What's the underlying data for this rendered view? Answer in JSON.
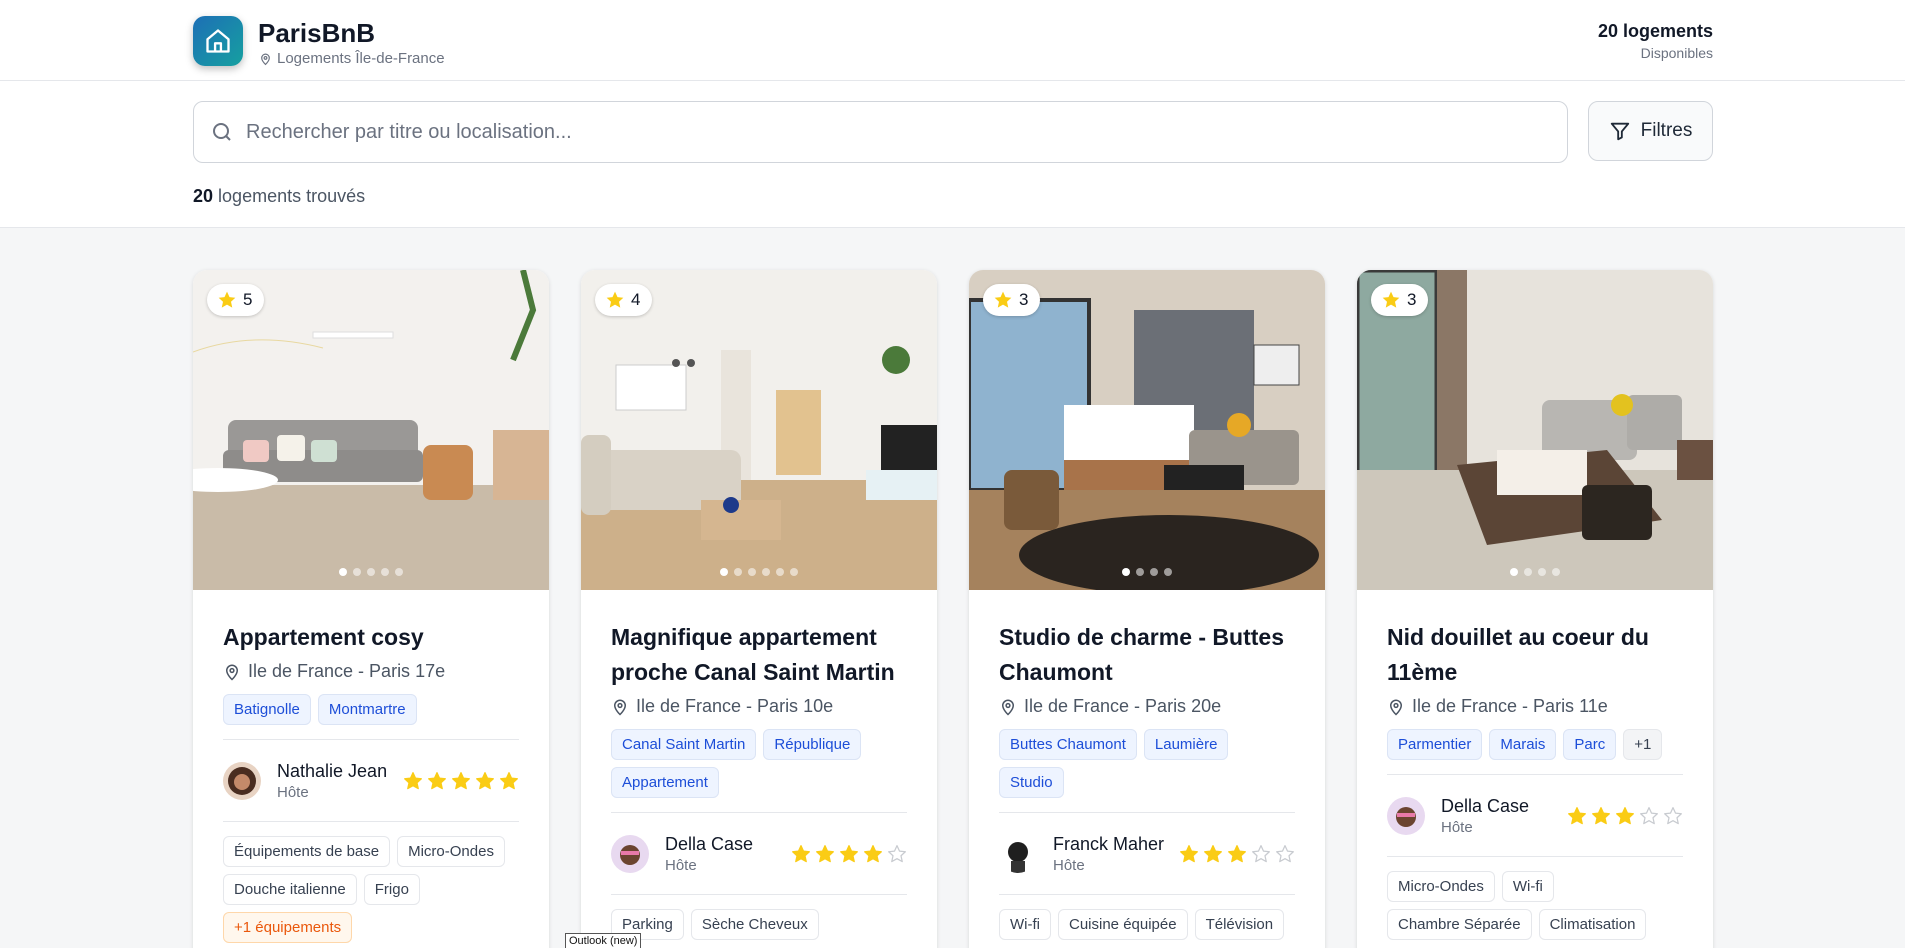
{
  "app": {
    "name": "ParisBnB",
    "subtitle": "Logements Île-de-France",
    "count_label": "20 logements",
    "count_sub": "Disponibles"
  },
  "search": {
    "placeholder": "Rechercher par titre ou localisation...",
    "value": ""
  },
  "filters": {
    "label": "Filtres"
  },
  "results": {
    "count": "20",
    "label": "logements trouvés"
  },
  "listings": [
    {
      "rating": "5",
      "title": "Appartement cosy",
      "location": "Ile de France - Paris 17e",
      "tags": [
        "Batignolle",
        "Montmartre"
      ],
      "host": {
        "name": "Nathalie Jean",
        "role": "Hôte",
        "stars": 5
      },
      "amenities": [
        "Équipements de base",
        "Micro-Ondes",
        "Douche italienne",
        "Frigo"
      ],
      "more": "+1 équipements",
      "photo_dots": 5,
      "active_dot": 0
    },
    {
      "rating": "4",
      "title": "Magnifique appartement proche Canal Saint Martin",
      "location": "Ile de France - Paris 10e",
      "tags": [
        "Canal Saint Martin",
        "République",
        "Appartement"
      ],
      "host": {
        "name": "Della Case",
        "role": "Hôte",
        "stars": 4
      },
      "amenities": [
        "Parking",
        "Sèche Cheveux"
      ],
      "photo_dots": 6,
      "active_dot": 0
    },
    {
      "rating": "3",
      "title": "Studio de charme - Buttes Chaumont",
      "location": "Ile de France - Paris 20e",
      "tags": [
        "Buttes Chaumont",
        "Laumière",
        "Studio"
      ],
      "host": {
        "name": "Franck Maher",
        "role": "Hôte",
        "stars": 3
      },
      "amenities": [
        "Wi-fi",
        "Cuisine équipée",
        "Télévision"
      ],
      "photo_dots": 4,
      "active_dot": 0
    },
    {
      "rating": "3",
      "title": "Nid douillet au coeur du 11ème",
      "location": "Ile de France - Paris 11e",
      "tags": [
        "Parmentier",
        "Marais",
        "Parc",
        "+1"
      ],
      "host": {
        "name": "Della Case",
        "role": "Hôte",
        "stars": 3
      },
      "amenities": [
        "Micro-Ondes",
        "Wi-fi",
        "Chambre Séparée",
        "Climatisation"
      ],
      "photo_dots": 4,
      "active_dot": 0
    }
  ],
  "tooltip": "Outlook (new)",
  "colors": {
    "accent": "#1d4ed8",
    "star": "#facc15",
    "brand_gradient": [
      "#1d6fb6",
      "#16a0a0"
    ]
  },
  "icons": {
    "logo": "home-icon",
    "location": "map-pin-icon",
    "search": "search-icon",
    "filter": "filter-icon",
    "rating": "star-icon"
  }
}
